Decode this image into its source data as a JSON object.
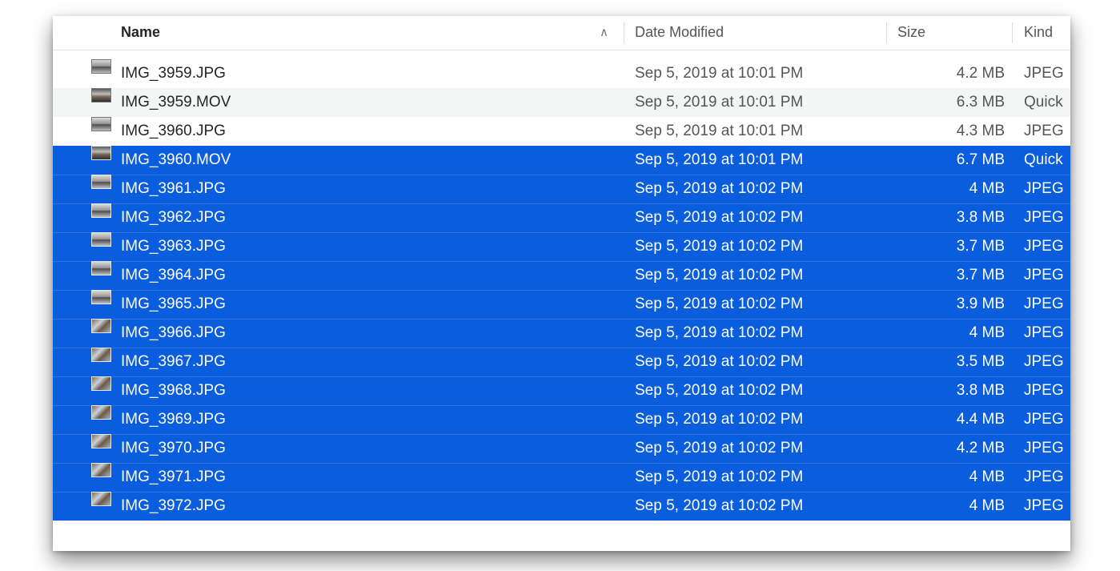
{
  "columns": {
    "name": "Name",
    "sort_icon": "chevron-up-icon",
    "date_modified": "Date Modified",
    "size": "Size",
    "kind": "Kind"
  },
  "colors": {
    "selection": "#0a5ddd",
    "alt_row": "#f4f5f5"
  },
  "files": [
    {
      "name": "IMG_3959.JPG",
      "date": "Sep 5, 2019 at 10:01 PM",
      "size": "4.2 MB",
      "kind": "JPEG",
      "selected": false,
      "icon": "jpeg-thumbnail-icon"
    },
    {
      "name": "IMG_3959.MOV",
      "date": "Sep 5, 2019 at 10:01 PM",
      "size": "6.3 MB",
      "kind": "Quick",
      "selected": false,
      "icon": "movie-thumbnail-icon"
    },
    {
      "name": "IMG_3960.JPG",
      "date": "Sep 5, 2019 at 10:01 PM",
      "size": "4.3 MB",
      "kind": "JPEG",
      "selected": false,
      "icon": "jpeg-thumbnail-icon"
    },
    {
      "name": "IMG_3960.MOV",
      "date": "Sep 5, 2019 at 10:01 PM",
      "size": "6.7 MB",
      "kind": "Quick",
      "selected": true,
      "icon": "movie-thumbnail-icon"
    },
    {
      "name": "IMG_3961.JPG",
      "date": "Sep 5, 2019 at 10:02 PM",
      "size": "4 MB",
      "kind": "JPEG",
      "selected": true,
      "icon": "jpeg-thumbnail-icon"
    },
    {
      "name": "IMG_3962.JPG",
      "date": "Sep 5, 2019 at 10:02 PM",
      "size": "3.8 MB",
      "kind": "JPEG",
      "selected": true,
      "icon": "jpeg-thumbnail-icon"
    },
    {
      "name": "IMG_3963.JPG",
      "date": "Sep 5, 2019 at 10:02 PM",
      "size": "3.7 MB",
      "kind": "JPEG",
      "selected": true,
      "icon": "jpeg-thumbnail-icon"
    },
    {
      "name": "IMG_3964.JPG",
      "date": "Sep 5, 2019 at 10:02 PM",
      "size": "3.7 MB",
      "kind": "JPEG",
      "selected": true,
      "icon": "jpeg-thumbnail-icon"
    },
    {
      "name": "IMG_3965.JPG",
      "date": "Sep 5, 2019 at 10:02 PM",
      "size": "3.9 MB",
      "kind": "JPEG",
      "selected": true,
      "icon": "jpeg-thumbnail-icon"
    },
    {
      "name": "IMG_3966.JPG",
      "date": "Sep 5, 2019 at 10:02 PM",
      "size": "4 MB",
      "kind": "JPEG",
      "selected": true,
      "icon": "jpeg-thumbnail-icon"
    },
    {
      "name": "IMG_3967.JPG",
      "date": "Sep 5, 2019 at 10:02 PM",
      "size": "3.5 MB",
      "kind": "JPEG",
      "selected": true,
      "icon": "jpeg-thumbnail-icon"
    },
    {
      "name": "IMG_3968.JPG",
      "date": "Sep 5, 2019 at 10:02 PM",
      "size": "3.8 MB",
      "kind": "JPEG",
      "selected": true,
      "icon": "jpeg-thumbnail-icon"
    },
    {
      "name": "IMG_3969.JPG",
      "date": "Sep 5, 2019 at 10:02 PM",
      "size": "4.4 MB",
      "kind": "JPEG",
      "selected": true,
      "icon": "jpeg-thumbnail-icon"
    },
    {
      "name": "IMG_3970.JPG",
      "date": "Sep 5, 2019 at 10:02 PM",
      "size": "4.2 MB",
      "kind": "JPEG",
      "selected": true,
      "icon": "jpeg-thumbnail-icon"
    },
    {
      "name": "IMG_3971.JPG",
      "date": "Sep 5, 2019 at 10:02 PM",
      "size": "4 MB",
      "kind": "JPEG",
      "selected": true,
      "icon": "jpeg-thumbnail-icon"
    },
    {
      "name": "IMG_3972.JPG",
      "date": "Sep 5, 2019 at 10:02 PM",
      "size": "4 MB",
      "kind": "JPEG",
      "selected": true,
      "icon": "jpeg-thumbnail-icon"
    }
  ]
}
